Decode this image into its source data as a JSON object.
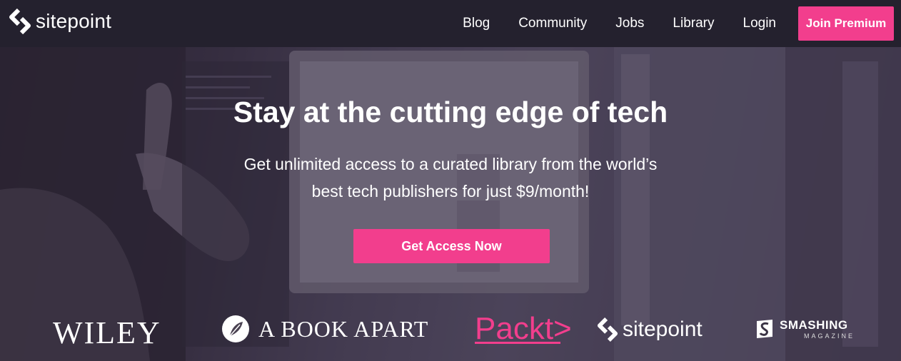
{
  "nav": {
    "brand": "sitepoint",
    "links": [
      "Blog",
      "Community",
      "Jobs",
      "Library",
      "Login"
    ],
    "join_label": "Join Premium"
  },
  "hero": {
    "title": "Stay at the cutting edge of tech",
    "subtitle_line1": "Get unlimited access to a curated library from the world’s",
    "subtitle_line2": "best tech publishers for just $9/month!",
    "cta_label": "Get Access Now"
  },
  "publishers": {
    "wiley": "WILEY",
    "book_apart": "A BOOK APART",
    "packt": "Packt>",
    "sitepoint": "sitepoint",
    "smashing_line1": "SMASHING",
    "smashing_line2": "MAGAZINE"
  },
  "colors": {
    "accent": "#f23e8d",
    "nav_bg": "#24212e"
  }
}
